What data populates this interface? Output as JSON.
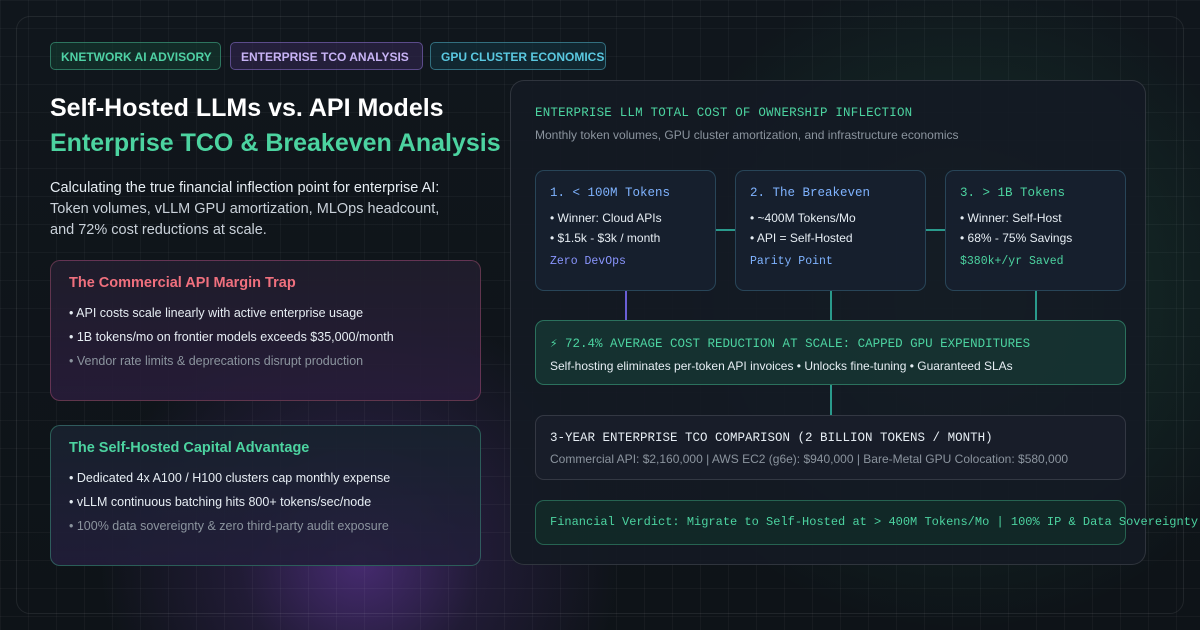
{
  "badges": [
    "KNETWORK AI ADVISORY",
    "ENTERPRISE TCO ANALYSIS",
    "GPU CLUSTER ECONOMICS"
  ],
  "headline": {
    "line1": "Self-Hosted LLMs vs. API Models",
    "line2": "Enterprise TCO & Breakeven Analysis"
  },
  "description": [
    "Calculating the true financial inflection point for enterprise AI:",
    "Token volumes, vLLM GPU amortization, MLOps headcount,",
    "and 72% cost reductions at scale."
  ],
  "cards": [
    {
      "title": "The Commercial API Margin Trap",
      "items": [
        "• API costs scale linearly with active enterprise usage",
        "• 1B tokens/mo on frontier models exceeds $35,000/month",
        "• Vendor rate limits & deprecations disrupt production"
      ]
    },
    {
      "title": "The Self-Hosted Capital Advantage",
      "items": [
        "• Dedicated 4x A100 / H100 clusters cap monthly expense",
        "• vLLM continuous batching hits 800+ tokens/sec/node",
        "• 100% data sovereignty & zero third-party audit exposure"
      ]
    }
  ],
  "panel": {
    "title": "ENTERPRISE LLM TOTAL COST OF OWNERSHIP INFLECTION",
    "subtitle": "Monthly token volumes, GPU cluster amortization, and infrastructure economics",
    "stages": [
      {
        "title": "1. < 100M Tokens",
        "lines": [
          "• Winner: Cloud APIs",
          "• $1.5k - $3k / month"
        ],
        "footer": "Zero DevOps"
      },
      {
        "title": "2. The Breakeven",
        "lines": [
          "• ~400M Tokens/Mo",
          "• API = Self-Hosted"
        ],
        "footer": "Parity Point"
      },
      {
        "title": "3. > 1B Tokens",
        "lines": [
          "• Winner: Self-Host",
          "• 68% - 75% Savings"
        ],
        "footer": "$380k+/yr Saved"
      }
    ],
    "highlight": {
      "title": "⚡ 72.4% AVERAGE COST REDUCTION AT SCALE: CAPPED GPU EXPENDITURES",
      "body": "Self-hosting eliminates per-token API invoices • Unlocks fine-tuning • Guaranteed SLAs"
    },
    "comparison": {
      "title": "3-YEAR ENTERPRISE TCO COMPARISON (2 BILLION TOKENS / MONTH)",
      "body": "Commercial API: $2,160,000 | AWS EC2 (g6e): $940,000 | Bare-Metal GPU Colocation: $580,000"
    },
    "verdict": "Financial Verdict: Migrate to Self-Hosted at > 400M Tokens/Mo | 100% IP & Data Sovereignty"
  },
  "colors": {
    "accent_green": "#4cd3a0",
    "accent_red": "#f0707e",
    "accent_blue": "#7fb3ff",
    "background": "#0f1419"
  }
}
